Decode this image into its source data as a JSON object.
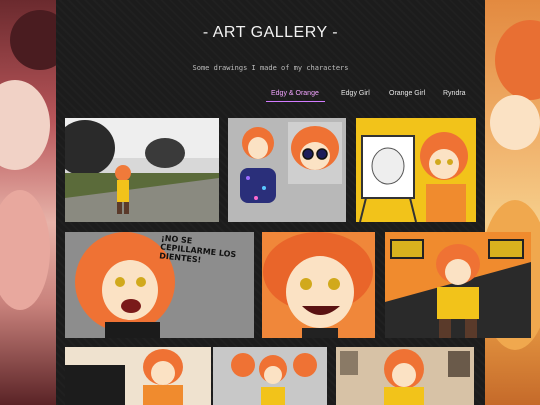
{
  "gallery": {
    "title": "- ART GALLERY -",
    "subtitle": "Some drawings I made of my characters"
  },
  "tabs": [
    {
      "label": "Edgy & Orange",
      "active": true
    },
    {
      "label": "Edgy Girl",
      "active": false
    },
    {
      "label": "Orange Girl",
      "active": false
    },
    {
      "label": "Ryndra",
      "active": false
    }
  ],
  "artwork_text": {
    "speech_bubble": "¡NO SE CEPILLARME LOS DIENTES!"
  },
  "colors": {
    "accent_tab": "#d27bff",
    "background": "#1c1c1c",
    "hair_orange": "#f07a3a",
    "jacket_yellow": "#f2c31a"
  }
}
